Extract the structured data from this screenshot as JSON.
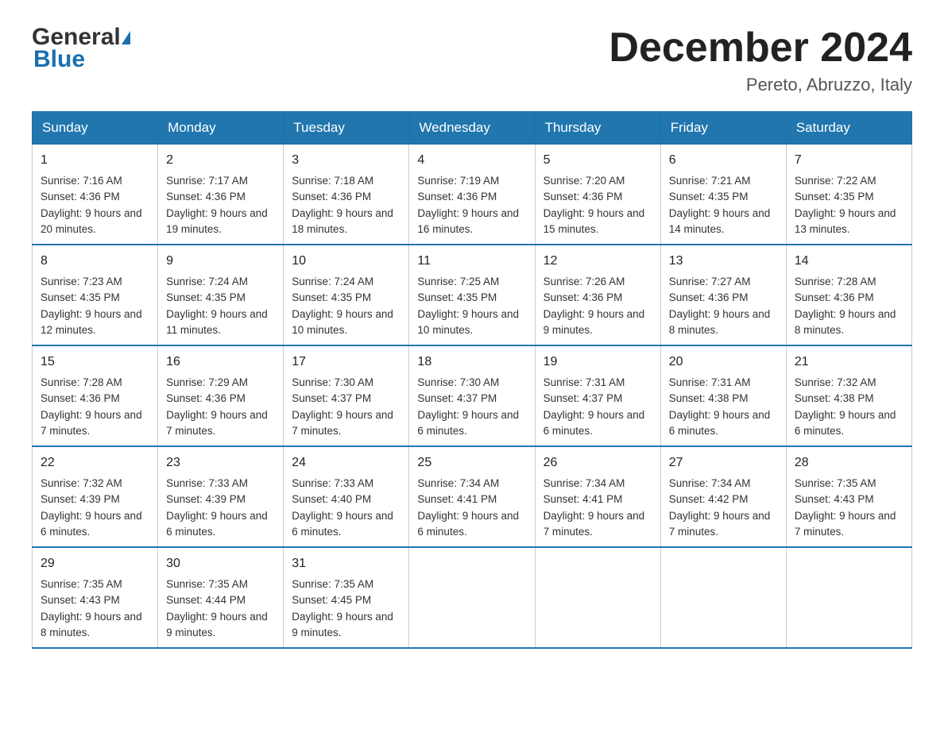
{
  "header": {
    "month_title": "December 2024",
    "location": "Pereto, Abruzzo, Italy"
  },
  "logo": {
    "line1": "General",
    "line2": "Blue"
  },
  "days_of_week": [
    "Sunday",
    "Monday",
    "Tuesday",
    "Wednesday",
    "Thursday",
    "Friday",
    "Saturday"
  ],
  "weeks": [
    [
      {
        "day": "1",
        "sunrise": "7:16 AM",
        "sunset": "4:36 PM",
        "daylight": "9 hours and 20 minutes."
      },
      {
        "day": "2",
        "sunrise": "7:17 AM",
        "sunset": "4:36 PM",
        "daylight": "9 hours and 19 minutes."
      },
      {
        "day": "3",
        "sunrise": "7:18 AM",
        "sunset": "4:36 PM",
        "daylight": "9 hours and 18 minutes."
      },
      {
        "day": "4",
        "sunrise": "7:19 AM",
        "sunset": "4:36 PM",
        "daylight": "9 hours and 16 minutes."
      },
      {
        "day": "5",
        "sunrise": "7:20 AM",
        "sunset": "4:36 PM",
        "daylight": "9 hours and 15 minutes."
      },
      {
        "day": "6",
        "sunrise": "7:21 AM",
        "sunset": "4:35 PM",
        "daylight": "9 hours and 14 minutes."
      },
      {
        "day": "7",
        "sunrise": "7:22 AM",
        "sunset": "4:35 PM",
        "daylight": "9 hours and 13 minutes."
      }
    ],
    [
      {
        "day": "8",
        "sunrise": "7:23 AM",
        "sunset": "4:35 PM",
        "daylight": "9 hours and 12 minutes."
      },
      {
        "day": "9",
        "sunrise": "7:24 AM",
        "sunset": "4:35 PM",
        "daylight": "9 hours and 11 minutes."
      },
      {
        "day": "10",
        "sunrise": "7:24 AM",
        "sunset": "4:35 PM",
        "daylight": "9 hours and 10 minutes."
      },
      {
        "day": "11",
        "sunrise": "7:25 AM",
        "sunset": "4:35 PM",
        "daylight": "9 hours and 10 minutes."
      },
      {
        "day": "12",
        "sunrise": "7:26 AM",
        "sunset": "4:36 PM",
        "daylight": "9 hours and 9 minutes."
      },
      {
        "day": "13",
        "sunrise": "7:27 AM",
        "sunset": "4:36 PM",
        "daylight": "9 hours and 8 minutes."
      },
      {
        "day": "14",
        "sunrise": "7:28 AM",
        "sunset": "4:36 PM",
        "daylight": "9 hours and 8 minutes."
      }
    ],
    [
      {
        "day": "15",
        "sunrise": "7:28 AM",
        "sunset": "4:36 PM",
        "daylight": "9 hours and 7 minutes."
      },
      {
        "day": "16",
        "sunrise": "7:29 AM",
        "sunset": "4:36 PM",
        "daylight": "9 hours and 7 minutes."
      },
      {
        "day": "17",
        "sunrise": "7:30 AM",
        "sunset": "4:37 PM",
        "daylight": "9 hours and 7 minutes."
      },
      {
        "day": "18",
        "sunrise": "7:30 AM",
        "sunset": "4:37 PM",
        "daylight": "9 hours and 6 minutes."
      },
      {
        "day": "19",
        "sunrise": "7:31 AM",
        "sunset": "4:37 PM",
        "daylight": "9 hours and 6 minutes."
      },
      {
        "day": "20",
        "sunrise": "7:31 AM",
        "sunset": "4:38 PM",
        "daylight": "9 hours and 6 minutes."
      },
      {
        "day": "21",
        "sunrise": "7:32 AM",
        "sunset": "4:38 PM",
        "daylight": "9 hours and 6 minutes."
      }
    ],
    [
      {
        "day": "22",
        "sunrise": "7:32 AM",
        "sunset": "4:39 PM",
        "daylight": "9 hours and 6 minutes."
      },
      {
        "day": "23",
        "sunrise": "7:33 AM",
        "sunset": "4:39 PM",
        "daylight": "9 hours and 6 minutes."
      },
      {
        "day": "24",
        "sunrise": "7:33 AM",
        "sunset": "4:40 PM",
        "daylight": "9 hours and 6 minutes."
      },
      {
        "day": "25",
        "sunrise": "7:34 AM",
        "sunset": "4:41 PM",
        "daylight": "9 hours and 6 minutes."
      },
      {
        "day": "26",
        "sunrise": "7:34 AM",
        "sunset": "4:41 PM",
        "daylight": "9 hours and 7 minutes."
      },
      {
        "day": "27",
        "sunrise": "7:34 AM",
        "sunset": "4:42 PM",
        "daylight": "9 hours and 7 minutes."
      },
      {
        "day": "28",
        "sunrise": "7:35 AM",
        "sunset": "4:43 PM",
        "daylight": "9 hours and 7 minutes."
      }
    ],
    [
      {
        "day": "29",
        "sunrise": "7:35 AM",
        "sunset": "4:43 PM",
        "daylight": "9 hours and 8 minutes."
      },
      {
        "day": "30",
        "sunrise": "7:35 AM",
        "sunset": "4:44 PM",
        "daylight": "9 hours and 9 minutes."
      },
      {
        "day": "31",
        "sunrise": "7:35 AM",
        "sunset": "4:45 PM",
        "daylight": "9 hours and 9 minutes."
      },
      null,
      null,
      null,
      null
    ]
  ]
}
